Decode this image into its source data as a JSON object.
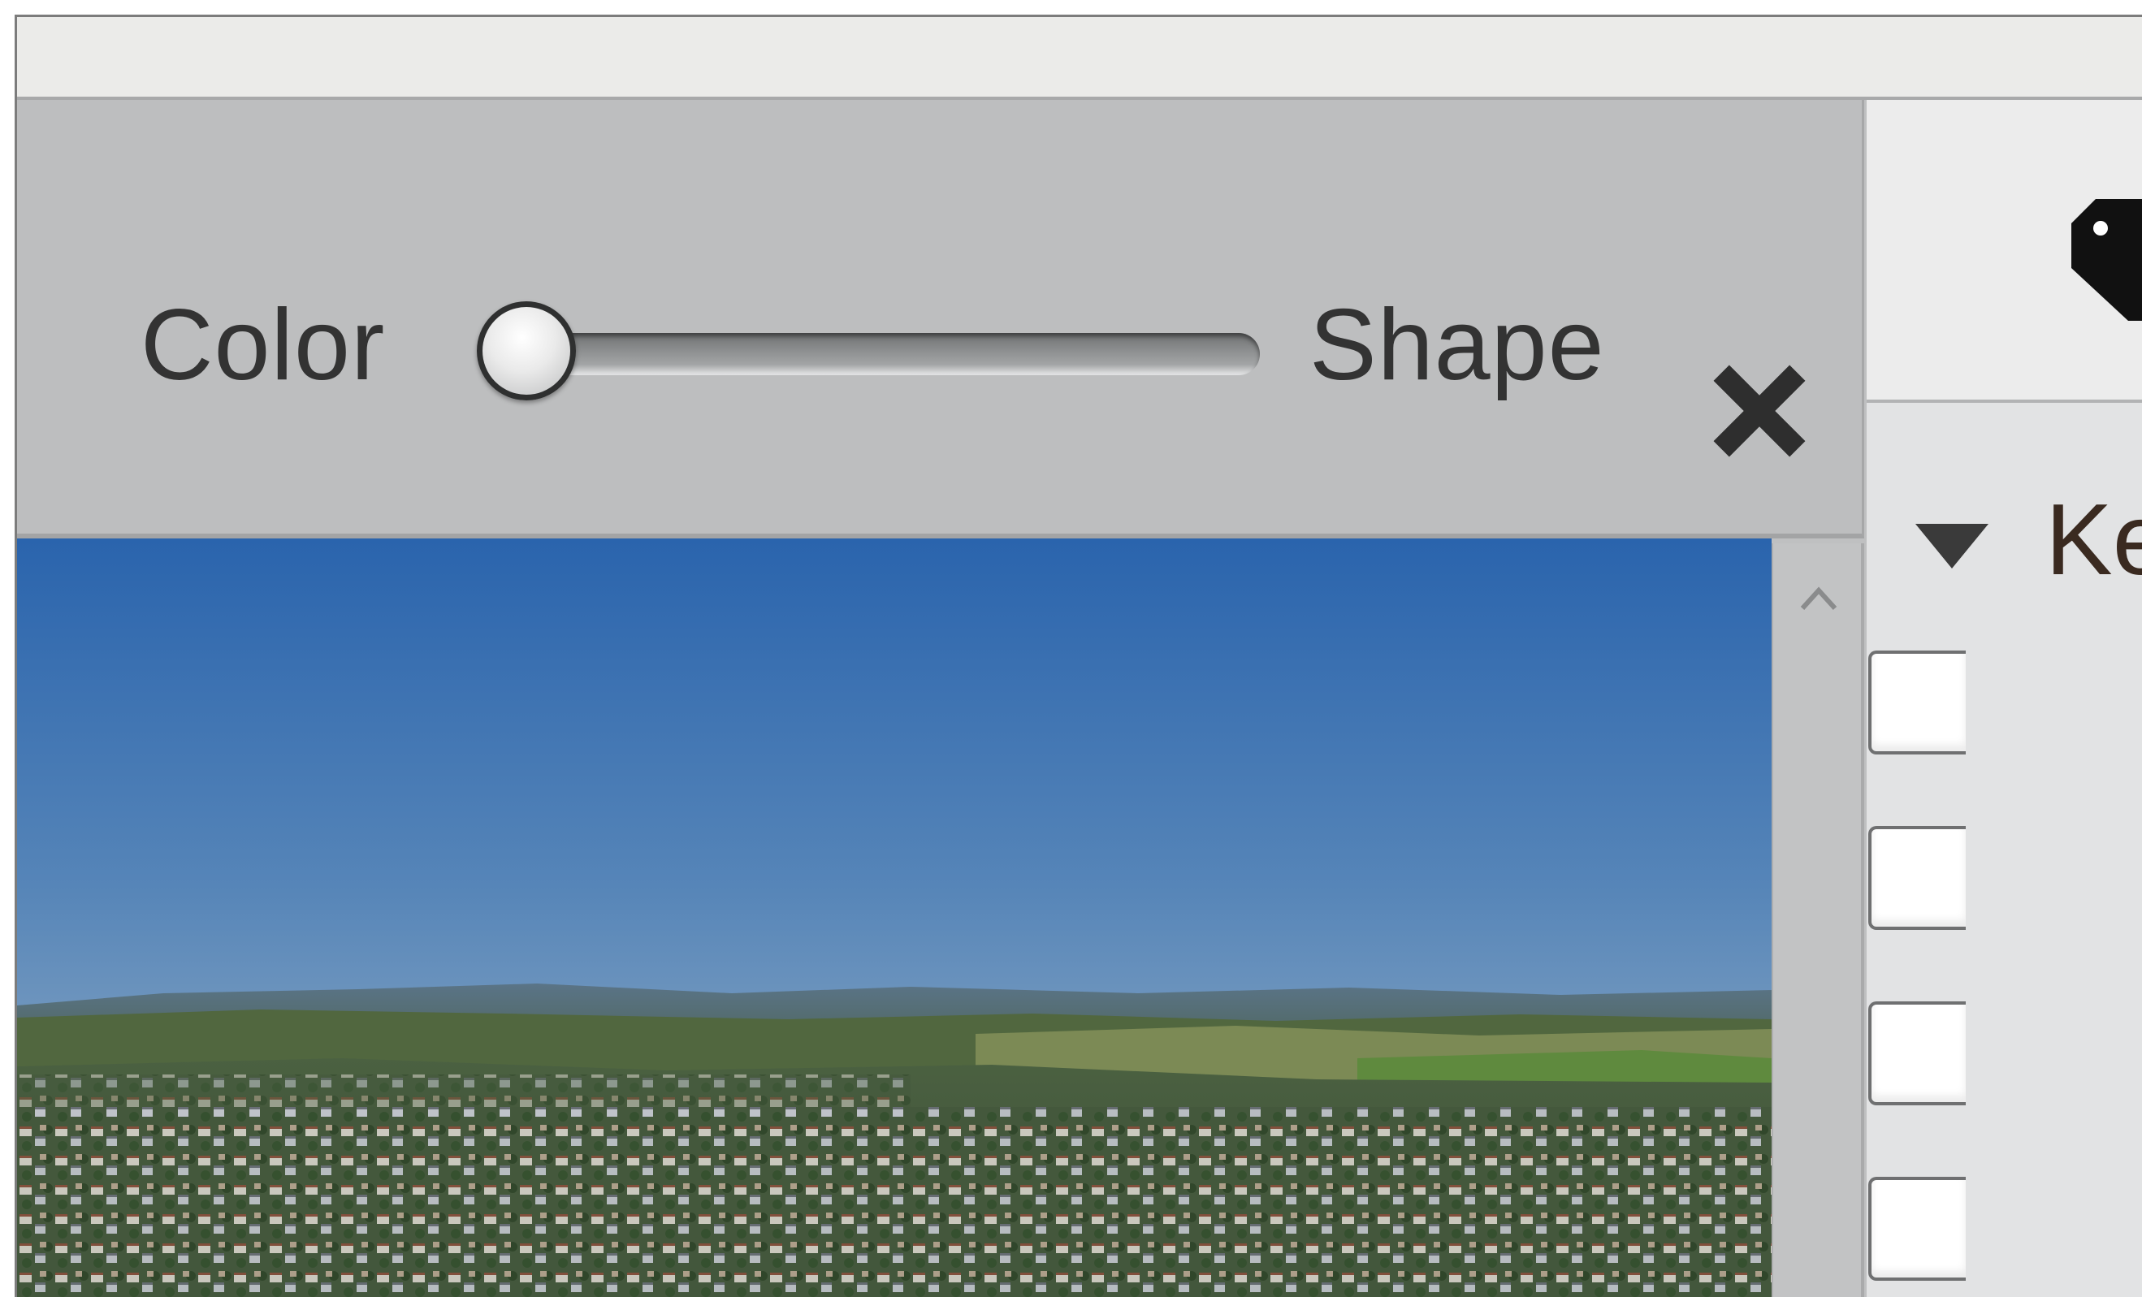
{
  "toolbar": {
    "similarity_left_label": "Color",
    "similarity_right_label": "Shape",
    "similarity_slider_value": 0
  },
  "side_panel": {
    "section_label": "Ke",
    "checkbox_count_visible": 4
  },
  "icons": {
    "close": "close-x-icon",
    "tag": "tag-icon",
    "disclosure": "disclosure-triangle-icon",
    "scroll_up": "scroll-up-arrow-icon"
  },
  "colors": {
    "titlebar": "#ebebe9",
    "toolbar": "#bdbebf",
    "panel": "#e2e3e4",
    "sky_top": "#2a66b0",
    "sky_bottom": "#8fa9c0"
  }
}
